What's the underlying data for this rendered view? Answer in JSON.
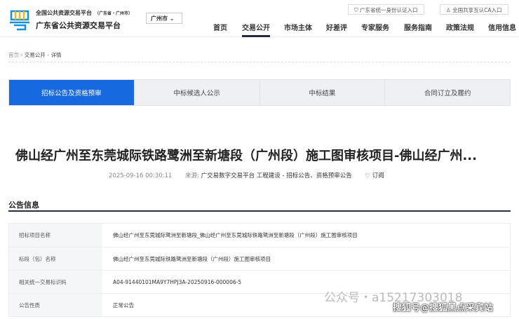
{
  "header": {
    "sub_title": "全国公共资源交易平台",
    "sub_region": "（广东省・广州市）",
    "brand": "广东省公共资源交易平台",
    "city": "广州市",
    "links": [
      "广东省统一身份认证入口",
      "全国共享互认CA入口"
    ],
    "nav": [
      "首页",
      "交易公开",
      "市场主体",
      "好差评",
      "专家服务",
      "服务指南",
      "政策法规",
      "信用信息"
    ]
  },
  "breadcrumb": [
    "首页",
    "交易公开",
    "详情"
  ],
  "tabs": [
    "招标公告及资格预审",
    "中标候选人公示",
    "中标结果",
    "合同订立及履约"
  ],
  "article": {
    "title": "佛山经广州至东莞城际铁路鹭洲至新塘段（广州段）施工图审核项目-佛山经广州...",
    "time": "2025-09-16 00:30:11",
    "source_label": "来源:",
    "source": "广交易数字交易平台 工程建设 - 招标公告、资格预审公告",
    "subscribe": "订阅"
  },
  "section": {
    "title": "公告信息",
    "rows": [
      {
        "label": "招标项目名称",
        "value": "佛山经广州至东莞城际鹭洲至新塘段_佛山经广州至东莞城际铁路鹭洲至新塘段（广州段）施工图审核项目"
      },
      {
        "label": "标段（包）名称",
        "value": "佛山经广州至东莞城际铁路鹭洲至新塘段（广州段）施工图审核项目"
      },
      {
        "label": "相关统一交易标识码",
        "value": "A04-91440101MA9Y7HPJ3A-20250916-000006-5"
      },
      {
        "label": "公告性质",
        "value": "正常公告"
      }
    ]
  },
  "watermarks": [
    "公众号・a15217303018",
    "搜狐号@搜狐黑点采宾站"
  ]
}
